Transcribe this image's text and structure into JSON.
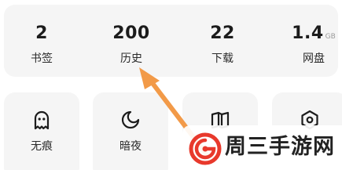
{
  "stats": [
    {
      "value": "2",
      "unit": "",
      "label": "书签"
    },
    {
      "value": "200",
      "unit": "",
      "label": "历史"
    },
    {
      "value": "22",
      "unit": "",
      "label": "下载"
    },
    {
      "value": "1.4",
      "unit": "GB",
      "label": "网盘"
    }
  ],
  "tiles": [
    {
      "icon": "ghost-icon",
      "label": "无痕"
    },
    {
      "icon": "moon-icon",
      "label": "暗夜"
    },
    {
      "icon": "book-icon",
      "label": ""
    },
    {
      "icon": "hexagon-icon",
      "label": ""
    }
  ],
  "watermark": {
    "text": "周三手游网"
  },
  "colors": {
    "card_bg": "#f5f5f5",
    "text": "#1c1c1c",
    "unit": "#9a9a9a",
    "arrow": "#f29a48",
    "logo_red": "#e8392c"
  }
}
